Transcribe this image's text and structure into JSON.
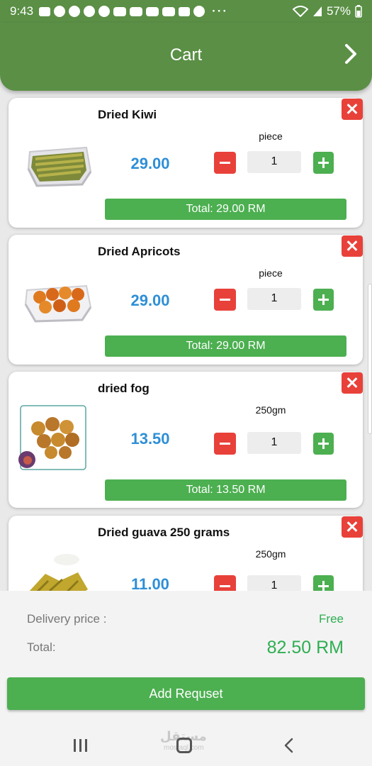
{
  "status_bar": {
    "time": "9:43",
    "battery": "57%"
  },
  "header": {
    "title": "Cart"
  },
  "items": [
    {
      "name": "Dried Kiwi",
      "price": "29.00",
      "unit": "piece",
      "qty": "1",
      "total": "Total: 29.00 RM"
    },
    {
      "name": "Dried Apricots",
      "price": "29.00",
      "unit": "piece",
      "qty": "1",
      "total": "Total: 29.00 RM"
    },
    {
      "name": "dried fog",
      "price": "13.50",
      "unit": "250gm",
      "qty": "1",
      "total": "Total: 13.50 RM"
    },
    {
      "name": "Dried guava 250 grams",
      "price": "11.00",
      "unit": "250gm",
      "qty": "1",
      "total": ""
    }
  ],
  "summary": {
    "delivery_label": "Delivery price :",
    "delivery_value": "Free",
    "total_label": "Total:",
    "total_value": "82.50 RM"
  },
  "actions": {
    "add_request": "Add Requset"
  },
  "watermark": {
    "arabic": "مستقل",
    "latin": "mostaql.com"
  },
  "colors": {
    "primary_green": "#5a8f45",
    "button_green": "#4caf50",
    "remove_red": "#e8413a",
    "price_blue": "#2e8fd6",
    "total_green": "#2fae52"
  }
}
